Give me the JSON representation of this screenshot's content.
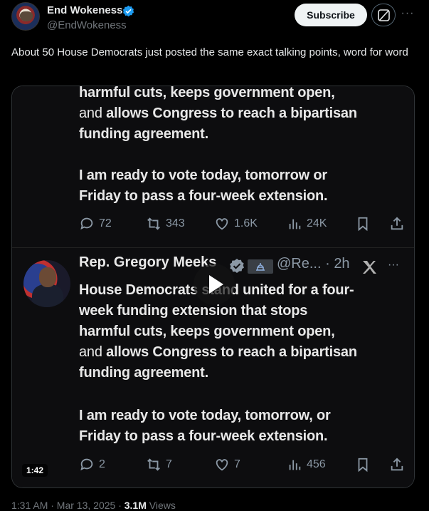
{
  "author": {
    "display_name": "End Wokeness",
    "handle": "@EndWokeness",
    "verified_color": "#1d9bf0"
  },
  "header_actions": {
    "subscribe_label": "Subscribe",
    "grok_icon": "grok-icon",
    "more_icon": "more-icon"
  },
  "tweet": {
    "text": "About 50 House Democrats just posted the same exact talking points, word for word"
  },
  "video": {
    "duration": "1:42",
    "upper_post": {
      "lines": [
        "harmful cuts, keeps government open,",
        "and allows Congress to reach a bipartisan",
        "funding agreement.",
        "",
        "I am ready to vote today, tomorrow or",
        "Friday to pass a four-week extension."
      ],
      "line_prefix_light": "and ",
      "replies": "72",
      "reposts": "343",
      "likes": "1.6K",
      "views": "24K"
    },
    "lower_post": {
      "name": "Rep. Gregory Meeks",
      "meta": "@Re... · 2h",
      "lines": [
        "House Democrats stand united for a four-",
        "week funding extension that stops",
        "harmful cuts, keeps government open,",
        "and allows Congress to reach a bipartisan",
        "funding agreement.",
        "",
        "I am ready to vote today, tomorrow, or",
        "Friday to pass a four-week extension."
      ],
      "replies": "2",
      "reposts": "7",
      "likes": "7",
      "views": "456"
    }
  },
  "footer": {
    "timestamp": "1:31 AM · Mar 13, 2025 · ",
    "views_count": "3.1M",
    "views_label": " Views"
  }
}
